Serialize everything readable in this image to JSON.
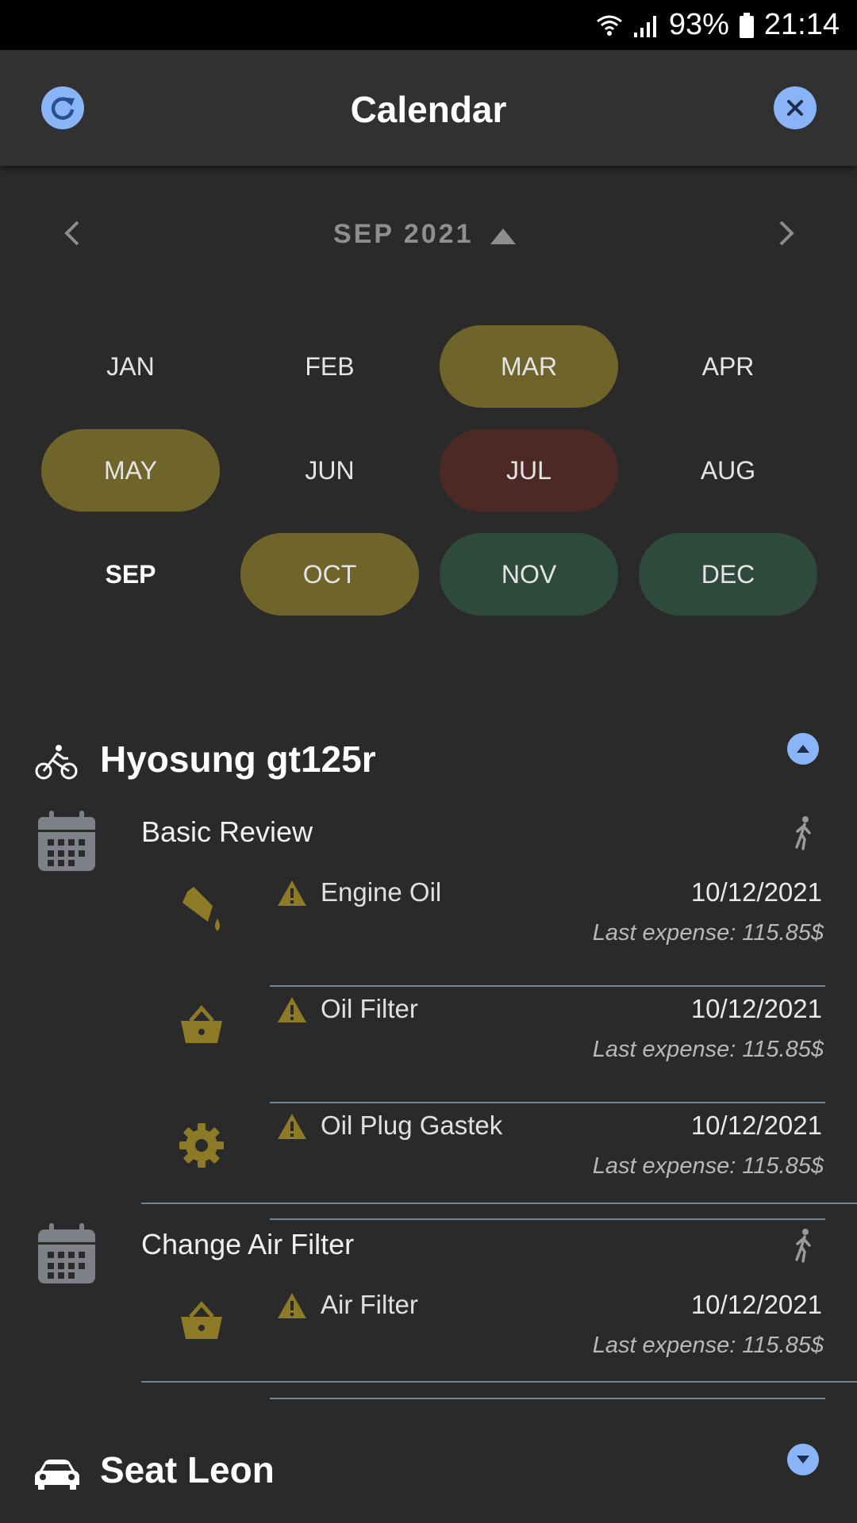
{
  "status_bar": {
    "battery": "93%",
    "time": "21:14",
    "icons": [
      "wifi-icon",
      "signal-icon",
      "battery-icon"
    ]
  },
  "app_bar": {
    "title": "Calendar",
    "left_icon": "refresh-icon",
    "right_icon": "close-icon"
  },
  "month_nav": {
    "label": "SEP 2021",
    "prev_icon": "chevron-left-icon",
    "next_icon": "chevron-right-icon",
    "toggle_icon": "triangle-up-icon"
  },
  "months": [
    {
      "label": "JAN",
      "status": "none"
    },
    {
      "label": "FEB",
      "status": "none"
    },
    {
      "label": "MAR",
      "status": "warning"
    },
    {
      "label": "APR",
      "status": "none"
    },
    {
      "label": "MAY",
      "status": "warning"
    },
    {
      "label": "JUN",
      "status": "none"
    },
    {
      "label": "JUL",
      "status": "overdue"
    },
    {
      "label": "AUG",
      "status": "none"
    },
    {
      "label": "SEP",
      "status": "current"
    },
    {
      "label": "OCT",
      "status": "warning"
    },
    {
      "label": "NOV",
      "status": "ok"
    },
    {
      "label": "DEC",
      "status": "ok"
    }
  ],
  "colors": {
    "warning": "#6f6429",
    "overdue": "#4d2925",
    "ok": "#2e4a3c",
    "accent": "#8ab4f8",
    "icon_gold": "#8c7a26",
    "icon_gray": "#7e8187"
  },
  "vehicles": [
    {
      "name": "Hyosung gt125r",
      "icon": "motorbike-icon",
      "expanded": true,
      "tasks": [
        {
          "title": "Basic Review",
          "parts": [
            {
              "name": "Engine Oil",
              "icon": "oil-can-icon",
              "date": "10/12/2021",
              "expense": "Last expense: 115.85$"
            },
            {
              "name": "Oil Filter",
              "icon": "basket-icon",
              "date": "10/12/2021",
              "expense": "Last expense: 115.85$"
            },
            {
              "name": "Oil Plug Gastek",
              "icon": "gear-icon",
              "date": "10/12/2021",
              "expense": "Last expense: 115.85$"
            }
          ]
        },
        {
          "title": "Change Air Filter",
          "parts": [
            {
              "name": "Air Filter",
              "icon": "basket-icon",
              "date": "10/12/2021",
              "expense": "Last expense: 115.85$"
            }
          ]
        }
      ]
    },
    {
      "name": "Seat Leon",
      "icon": "car-icon",
      "expanded": false,
      "tasks": []
    }
  ]
}
